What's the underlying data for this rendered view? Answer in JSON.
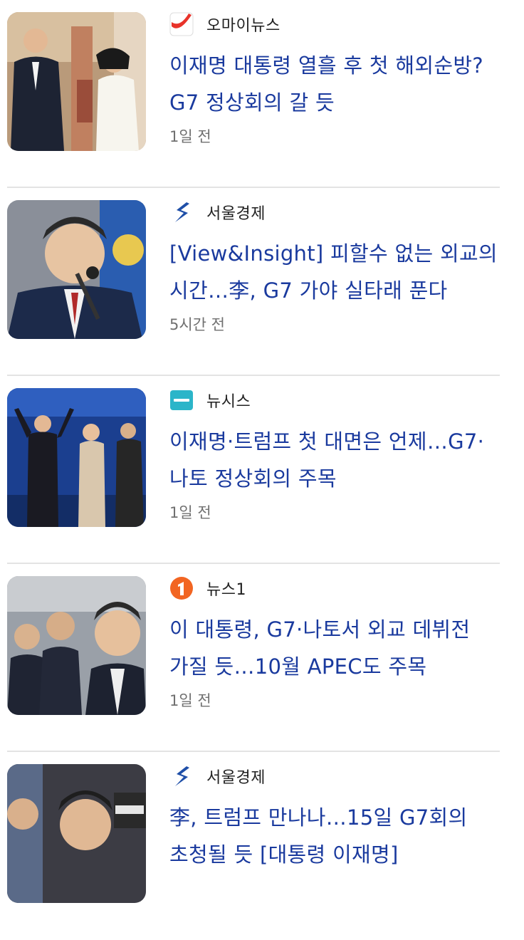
{
  "articles": [
    {
      "source": "오마이뉴스",
      "source_logo": "ohmynews-logo",
      "headline": "이재명 대통령 열흘 후 첫 해외순방? G7 정상회의 갈 듯",
      "time": "1일 전"
    },
    {
      "source": "서울경제",
      "source_logo": "seoul-economic-logo",
      "headline": "[View&Insight] 피할수 없는 외교의 시간…李, G7 가야 실타래 푼다",
      "time": "5시간 전"
    },
    {
      "source": "뉴시스",
      "source_logo": "newsis-logo",
      "logo_text": "뉴시스",
      "headline": "이재명·트럼프 첫 대면은 언제…G7·나토 정상회의 주목",
      "time": "1일 전"
    },
    {
      "source": "뉴스1",
      "source_logo": "news1-logo",
      "headline": "이 대통령, G7·나토서 외교 데뷔전 가질 듯…10월 APEC도 주목",
      "time": "1일 전"
    },
    {
      "source": "서울경제",
      "source_logo": "seoul-economic-logo",
      "headline": "李, 트럼프 만나나…15일 G7회의 초청될 듯 [대통령 이재명]",
      "time": ""
    }
  ],
  "colors": {
    "headline": "#1a3a9e",
    "source": "#222222",
    "time": "#707070",
    "divider": "#e3e3e3",
    "ohmynews_red": "#e8332a",
    "seoul_blue": "#1f4fa8",
    "newsis_teal": "#2bb5c9",
    "news1_orange": "#f26522"
  }
}
